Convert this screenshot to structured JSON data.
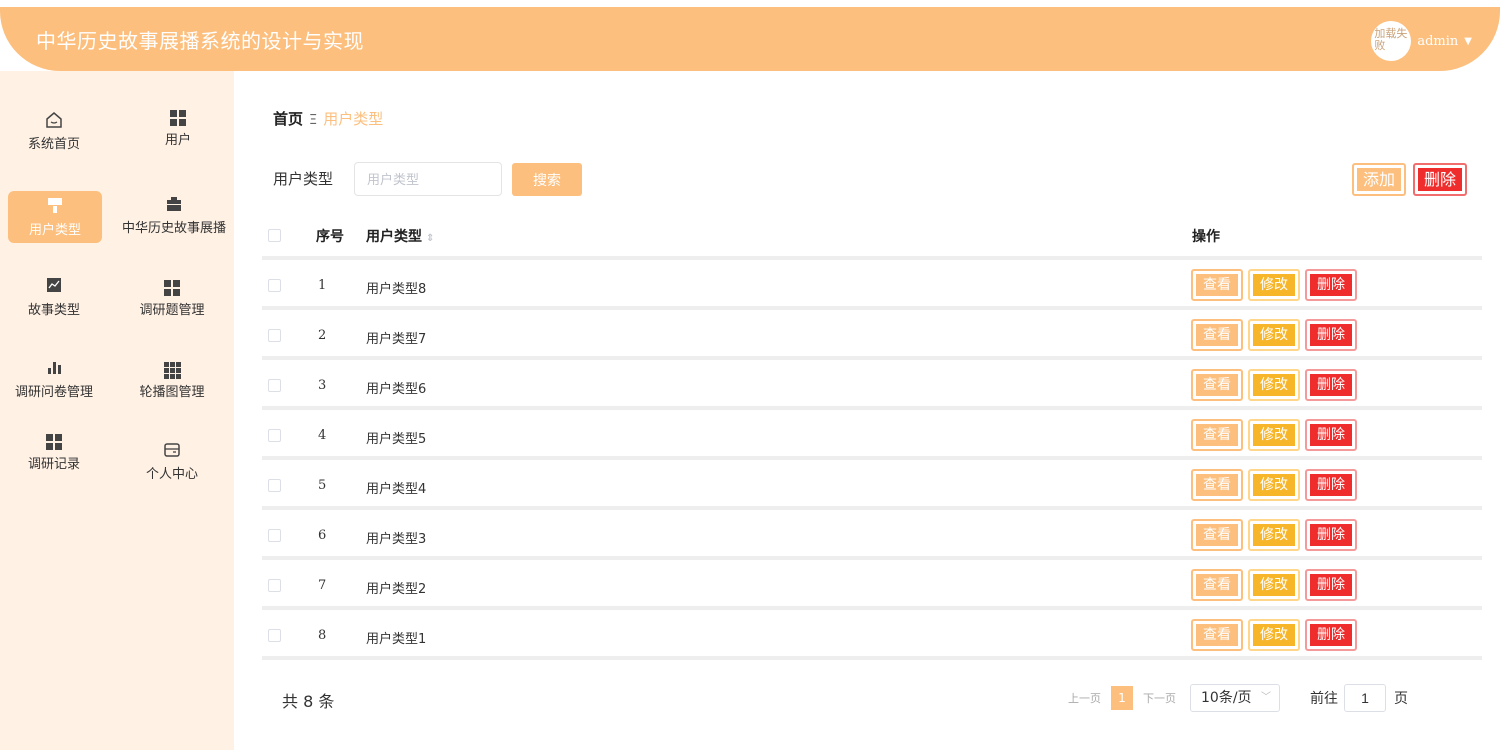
{
  "header": {
    "title": "中华历史故事展播系统的设计与实现",
    "avatar_alt": "加载失败",
    "username": "admin",
    "caret": "▼"
  },
  "sidebar": {
    "items": [
      {
        "label": "系统首页",
        "icon": "home-icon"
      },
      {
        "label": "用户",
        "icon": "grid-icon"
      },
      {
        "label": "用户类型",
        "icon": "brush-icon",
        "active": true
      },
      {
        "label": "中华历史故事展播",
        "icon": "briefcase-icon"
      },
      {
        "label": "故事类型",
        "icon": "chart-icon"
      },
      {
        "label": "调研题管理",
        "icon": "grid-icon"
      },
      {
        "label": "调研问卷管理",
        "icon": "bar-chart-icon"
      },
      {
        "label": "轮播图管理",
        "icon": "grid9-icon"
      },
      {
        "label": "调研记录",
        "icon": "grid-icon"
      },
      {
        "label": "个人中心",
        "icon": "wallet-icon"
      }
    ]
  },
  "breadcrumb": {
    "home": "首页",
    "separator": "Ξ",
    "current": "用户类型"
  },
  "search": {
    "label": "用户类型",
    "placeholder": "用户类型",
    "value": "",
    "button": "搜索"
  },
  "actions": {
    "add": "添加",
    "delete": "删除"
  },
  "table": {
    "headers": {
      "index": "序号",
      "name": "用户类型",
      "ops": "操作"
    },
    "op_labels": {
      "view": "查看",
      "edit": "修改",
      "delete": "删除"
    },
    "rows": [
      {
        "index": "1",
        "name": "用户类型8"
      },
      {
        "index": "2",
        "name": "用户类型7"
      },
      {
        "index": "3",
        "name": "用户类型6"
      },
      {
        "index": "4",
        "name": "用户类型5"
      },
      {
        "index": "5",
        "name": "用户类型4"
      },
      {
        "index": "6",
        "name": "用户类型3"
      },
      {
        "index": "7",
        "name": "用户类型2"
      },
      {
        "index": "8",
        "name": "用户类型1"
      }
    ]
  },
  "pagination": {
    "total": "共 8 条",
    "prev": "上一页",
    "current_page": "1",
    "next": "下一页",
    "page_size": "10条/页",
    "goto_label": "前往",
    "goto_value": "1",
    "goto_unit": "页"
  },
  "colors": {
    "accent": "#fcbf7e",
    "sidebar_bg": "#fff1e4",
    "edit": "#f7b52a",
    "danger": "#ef2d2d"
  }
}
